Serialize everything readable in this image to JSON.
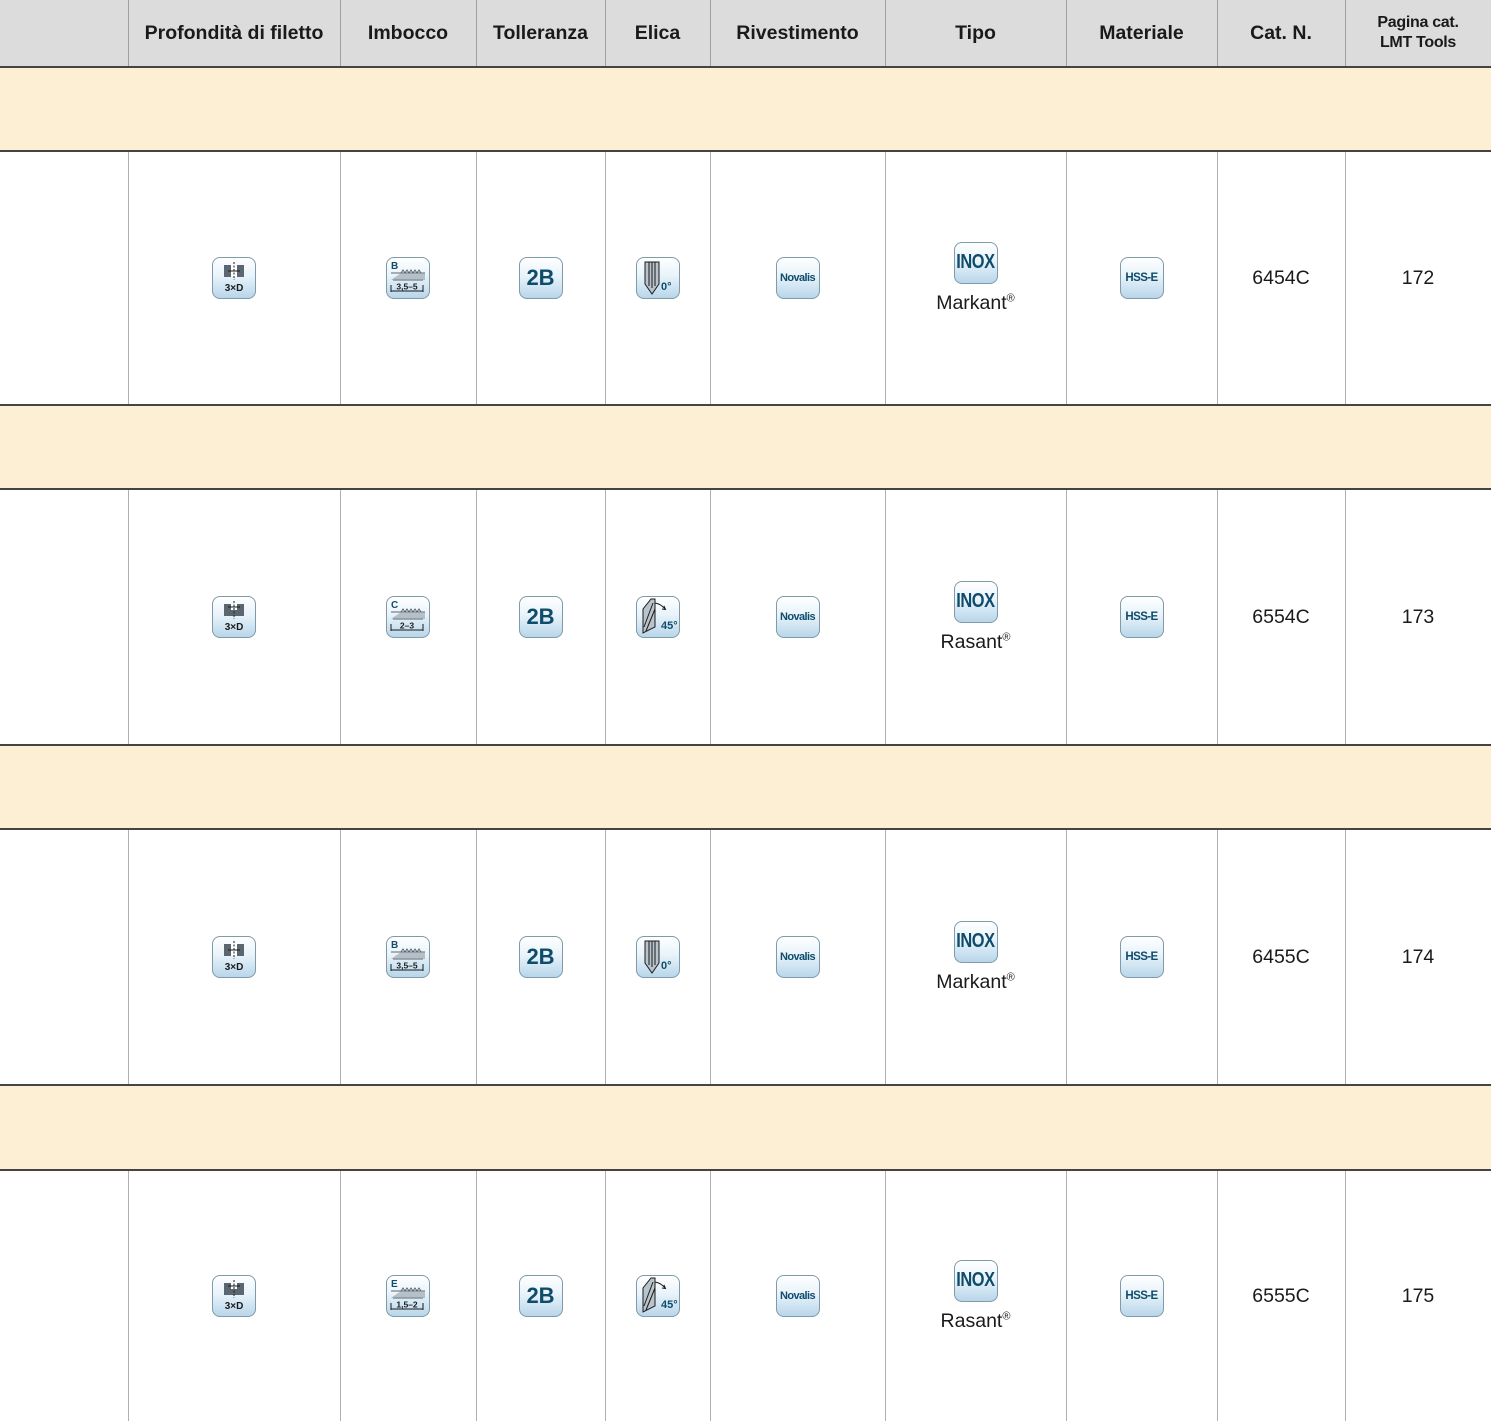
{
  "columns": {
    "profondita": "Profondità di filetto",
    "imbocco": "Imbocco",
    "tolleranza": "Tolleranza",
    "elica": "Elica",
    "rivestimento": "Rivestimento",
    "tipo": "Tipo",
    "materiale": "Materiale",
    "catn": "Cat. N.",
    "pagina_line1": "Pagina cat.",
    "pagina_line2": "LMT Tools"
  },
  "rows": [
    {
      "depth_icon": "blind-hole-depth-icon",
      "depth_label": "3×D",
      "chamfer_icon": "chamfer-form-icon",
      "chamfer_letter": "B",
      "chamfer_range": "3,5–5",
      "tolerance": "2B",
      "helix_icon": "straight-flute-icon",
      "helix_angle": "0°",
      "coating": "Novalis",
      "type_badge": "INOX",
      "type_name": "Markant",
      "type_mark": "®",
      "material": "HSS-E",
      "cat_no": "6454C",
      "page": "172"
    },
    {
      "depth_icon": "through-hole-depth-icon",
      "depth_label": "3×D",
      "chamfer_icon": "chamfer-form-icon",
      "chamfer_letter": "C",
      "chamfer_range": "2–3",
      "tolerance": "2B",
      "helix_icon": "spiral-flute-icon",
      "helix_angle": "45°",
      "coating": "Novalis",
      "type_badge": "INOX",
      "type_name": "Rasant",
      "type_mark": "®",
      "material": "HSS-E",
      "cat_no": "6554C",
      "page": "173"
    },
    {
      "depth_icon": "blind-hole-depth-icon",
      "depth_label": "3×D",
      "chamfer_icon": "chamfer-form-icon",
      "chamfer_letter": "B",
      "chamfer_range": "3,5–5",
      "tolerance": "2B",
      "helix_icon": "straight-flute-icon",
      "helix_angle": "0°",
      "coating": "Novalis",
      "type_badge": "INOX",
      "type_name": "Markant",
      "type_mark": "®",
      "material": "HSS-E",
      "cat_no": "6455C",
      "page": "174"
    },
    {
      "depth_icon": "through-hole-depth-icon",
      "depth_label": "3×D",
      "chamfer_icon": "chamfer-form-icon",
      "chamfer_letter": "E",
      "chamfer_range": "1,5–2",
      "tolerance": "2B",
      "helix_icon": "spiral-flute-icon",
      "helix_angle": "45°",
      "coating": "Novalis",
      "type_badge": "INOX",
      "type_name": "Rasant",
      "type_mark": "®",
      "material": "HSS-E",
      "cat_no": "6555C",
      "page": "175"
    }
  ],
  "colors": {
    "header_bg": "#dcdcdc",
    "band_bg": "#fdefd4",
    "icon_text": "#0f4c6b",
    "icon_border": "#7f9aa8"
  }
}
